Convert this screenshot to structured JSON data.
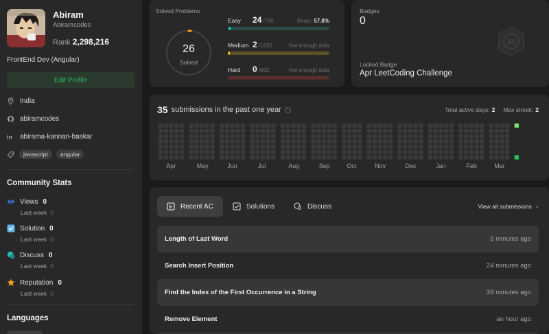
{
  "profile": {
    "name": "Abiram",
    "handle": "Abiramcodes",
    "rank_label": "Rank",
    "rank": "2,298,216",
    "bio": "FrontEnd Dev (Angular)",
    "edit_label": "Edit Profile",
    "location": "India",
    "github": "abiramcodes",
    "linkedin": "abirama-kannan-baskar",
    "skills": [
      "javascript",
      "angular"
    ]
  },
  "community": {
    "title": "Community Stats",
    "stats": [
      {
        "label": "Views",
        "value": "0",
        "sub": "Last week",
        "sub_value": "0",
        "icon": "eye-icon",
        "color": "#3b82f6"
      },
      {
        "label": "Solution",
        "value": "0",
        "sub": "Last week",
        "sub_value": "0",
        "icon": "solution-icon",
        "color": "#5fb6e8"
      },
      {
        "label": "Discuss",
        "value": "0",
        "sub": "Last week",
        "sub_value": "0",
        "icon": "discuss-icon",
        "color": "#2cbbb0"
      },
      {
        "label": "Reputation",
        "value": "0",
        "sub": "Last week",
        "sub_value": "0",
        "icon": "star-icon",
        "color": "#ffa116"
      }
    ]
  },
  "languages": {
    "title": "Languages"
  },
  "solved": {
    "label": "Solved Problems",
    "total": "26",
    "total_label": "Solved",
    "easy": {
      "name": "Easy",
      "count": "24",
      "total": "/786",
      "right_label": "Beats",
      "right_value": "57.8%",
      "progress": 0.0305,
      "color": "#00b8a3",
      "track": "#2a4a44"
    },
    "medium": {
      "name": "Medium",
      "count": "2",
      "total": "/1630",
      "right_label": "Not enough data",
      "right_value": "",
      "progress": 0.0012,
      "color": "#ffc01e",
      "track": "#5a4f26"
    },
    "hard": {
      "name": "Hard",
      "count": "0",
      "total": "/692",
      "right_label": "Not enough data",
      "right_value": "",
      "progress": 0,
      "color": "#ef4743",
      "track": "#5a2e2d"
    }
  },
  "badges": {
    "label": "Badges",
    "count": "0",
    "locked_label": "Locked Badge",
    "locked_name": "Apr LeetCoding Challenge"
  },
  "submissions": {
    "count": "35",
    "text": "submissions in the past one year",
    "active_days_label": "Total active days:",
    "active_days": "2",
    "streak_label": "Max streak:",
    "streak": "2",
    "months": [
      "Apr",
      "May",
      "Jun",
      "Jul",
      "Aug",
      "Sep",
      "Oct",
      "Nov",
      "Dec",
      "Jan",
      "Feb",
      "Mar"
    ]
  },
  "recent": {
    "tabs": [
      "Recent AC",
      "Solutions",
      "Discuss"
    ],
    "view_all": "View all submissions",
    "rows": [
      {
        "title": "Length of Last Word",
        "ago": "5 minutes ago"
      },
      {
        "title": "Search Insert Position",
        "ago": "24 minutes ago"
      },
      {
        "title": "Find the Index of the First Occurrence in a String",
        "ago": "39 minutes ago"
      },
      {
        "title": "Remove Element",
        "ago": "an hour ago"
      }
    ]
  }
}
